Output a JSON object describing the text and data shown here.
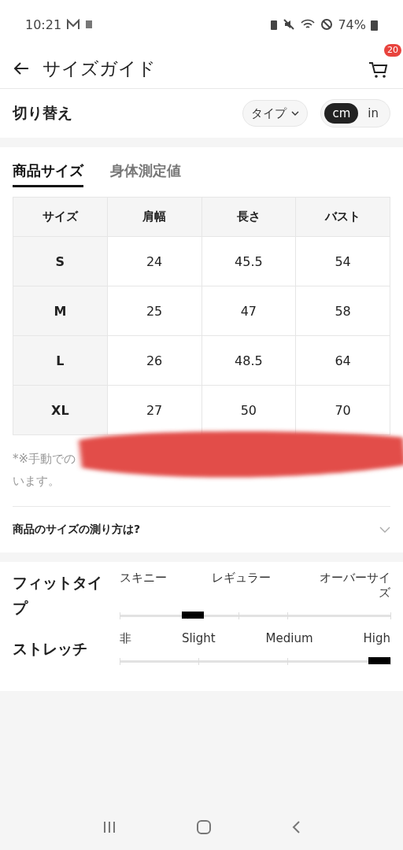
{
  "status_bar": {
    "time": "10:21",
    "battery": "74%"
  },
  "header": {
    "title": "サイズガイド",
    "cart_count": "20"
  },
  "switch_row": {
    "label": "切り替え",
    "type_button": "タイプ",
    "units": [
      {
        "label": "cm",
        "selected": true
      },
      {
        "label": "in",
        "selected": false
      }
    ]
  },
  "tabs": [
    {
      "label": "商品サイズ",
      "selected": true
    },
    {
      "label": "身体測定値",
      "selected": false
    }
  ],
  "table": {
    "columns": [
      "サイズ",
      "肩幅",
      "長さ",
      "バスト"
    ],
    "rows": [
      [
        "S",
        "24",
        "45.5",
        "54"
      ],
      [
        "M",
        "25",
        "47",
        "58"
      ],
      [
        "L",
        "26",
        "48.5",
        "64"
      ],
      [
        "XL",
        "27",
        "50",
        "70"
      ]
    ]
  },
  "note": {
    "line_1": "*※手動での",
    "line_2": "います。"
  },
  "accordion": {
    "label": "商品のサイズの測り方は?",
    "expanded": false
  },
  "scales": [
    {
      "label": "フィットタイプ",
      "kind": "fit",
      "options": [
        "スキニー",
        "レギュラー",
        "オーバーサイズ"
      ],
      "level": 0.25
    },
    {
      "label": "ストレッチ",
      "kind": "stretch",
      "options": [
        "非",
        "Slight",
        "Medium",
        "High"
      ],
      "level": 1
    }
  ]
}
